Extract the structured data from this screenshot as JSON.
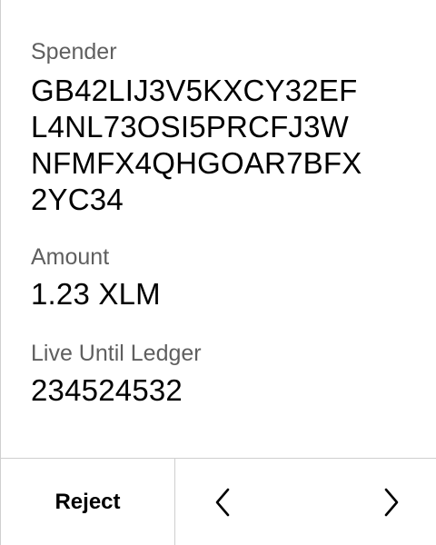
{
  "fields": {
    "spender": {
      "label": "Spender",
      "value_lines": [
        "GB42LIJ3V5KXCY32EF",
        "L4NL73OSI5PRCFJ3W",
        "NFMFX4QHGOAR7BFX",
        "2YC34"
      ]
    },
    "amount": {
      "label": "Amount",
      "value": "1.23 XLM"
    },
    "live_until_ledger": {
      "label": "Live Until Ledger",
      "value": "234524532"
    }
  },
  "footer": {
    "reject_label": "Reject",
    "previous_icon": "chevron-left-icon",
    "next_icon": "chevron-right-icon"
  },
  "colors": {
    "background": "#ffffff",
    "label_text": "#5f5f5f",
    "value_text": "#000000",
    "divider": "#cfcfcf"
  }
}
